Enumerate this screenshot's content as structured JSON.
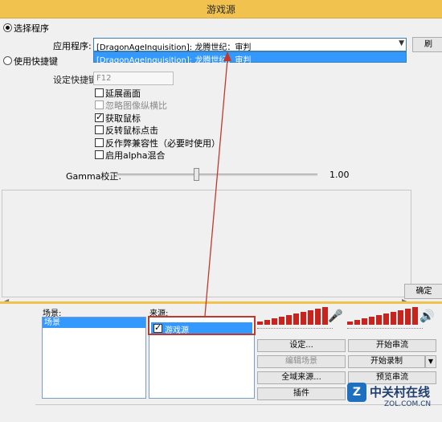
{
  "dialog": {
    "title": "游戏源",
    "select_program_label": "选择程序",
    "application_label": "应用程序:",
    "application_value": "[DragonAgeInquisition]: 龙腾世纪：审判",
    "dropdown_item": "[DragonAgeInquisition]: 龙腾世纪：审判",
    "browse_button": "刷",
    "use_hotkey_label": "使用快捷键",
    "hotkey_label": "设定快捷键",
    "hotkey_value": "F12",
    "options": [
      {
        "label": "延展画面",
        "checked": false,
        "disabled": false
      },
      {
        "label": "忽略图像纵横比",
        "checked": false,
        "disabled": true
      },
      {
        "label": "获取鼠标",
        "checked": true,
        "disabled": false
      },
      {
        "label": "反转鼠标点击",
        "checked": false,
        "disabled": false
      },
      {
        "label": "反作弊兼容性（必要时使用）",
        "checked": false,
        "disabled": false
      },
      {
        "label": "启用alpha混合",
        "checked": false,
        "disabled": false
      }
    ],
    "gamma_label": "Gamma校正:",
    "gamma_value": "1.00",
    "gamma_level": 0.4,
    "ok_button": "确定"
  },
  "main": {
    "scenes_label": "场景:",
    "scenes": [
      "场景"
    ],
    "sources_label": "来源:",
    "sources": [
      {
        "label": "游戏源",
        "checked": true
      }
    ],
    "buttons": {
      "settings": "设定...",
      "start_stream": "开始串流",
      "edit_scene": "编辑场景",
      "start_recording": "开始录制",
      "global_sources": "全域来源...",
      "preview_stream": "预览串流",
      "plugins": "插件"
    }
  },
  "watermark": {
    "brand": "中关村在线",
    "url": "ZOL.COM.CN"
  },
  "colors": {
    "title_bar": "#f2c24f",
    "selection": "#3399ff",
    "meter_red": "#c8231c",
    "annotation_red": "#c0392b"
  }
}
